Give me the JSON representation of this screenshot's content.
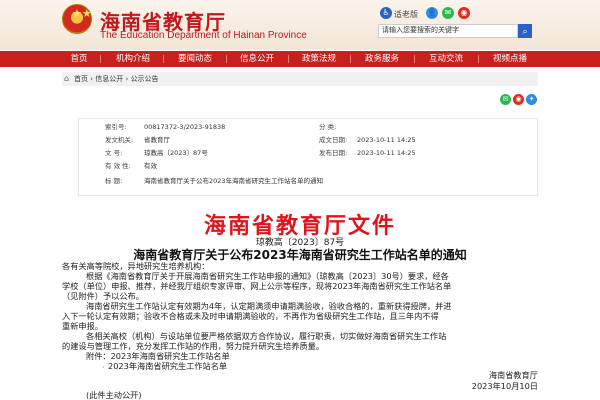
{
  "header": {
    "title": "海南省教育厅",
    "subtitle": "The Education Department of Hainan Province",
    "links": [
      "适老版"
    ],
    "search_placeholder": "请输入您要搜索的关键字"
  },
  "nav": {
    "items": [
      "首页",
      "机构介绍",
      "要闻动态",
      "信息公开",
      "政策法规",
      "政务服务",
      "互动交流",
      "视频点播"
    ]
  },
  "breadcrumb": {
    "items": [
      "首页",
      "信息公开",
      "公示公告"
    ],
    "separator": "›"
  },
  "meta": {
    "index_label": "索引号:",
    "index_value": "00817372-3/2023-91838",
    "category_label": "分    类:",
    "category_value": "",
    "org_label": "发文机关:",
    "org_value": "省教育厅",
    "date_label": "成文日期:",
    "date_value": "2023-10-11 14:25",
    "docno_label": "文    号:",
    "docno_value": "琼教高〔2023〕87号",
    "pubdate_label": "发布日期:",
    "pubdate_value": "2023-10-11 14:25",
    "validity_label": "有 效 性:",
    "validity_value": "有效",
    "title_label": "标    题:",
    "title_value": "海南省教育厅关于公布2023年海南省研究生工作站名单的通知"
  },
  "document": {
    "banner": "海南省教育厅文件",
    "number": "琼教高〔2023〕87号",
    "heading": "海南省教育厅关于公布2023年海南省研究生工作站名单的通知",
    "salutation": "各有关高等院校，异地研究生培养机构：",
    "para1_line1": "根据《海南省教育厅关于开展海南省研究生工作站申报的通知》（琼教高〔2023〕30号）要求，经各",
    "para1_line2": "学校（单位）申报、推荐，并经我厅组织专家评审、网上公示等程序，现将2023年海南省研究生工作站名单",
    "para1_line3": "（见附件）予以公布。",
    "para2_line1": "海南省研究生工作站认定有效期为4年，认定期满须申请期满验收，验收合格的，重新获得授牌，并进",
    "para2_line2": "入下一轮认定有效期；验收不合格或未及时申请期满验收的，不再作为省级研究生工作站，且三年内不得",
    "para2_line3": "重新申报。",
    "para3_line1": "各相关高校（机构）与设站单位要严格依据双方合作协议，履行职责，切实做好海南省研究生工作站",
    "para3_line2": "的建设与管理工作，充分发挥工作站的作用，努力提升研究生培养质量。",
    "attachment1": "附件：2023年海南省研究生工作站名单",
    "attachment2": "2023年海南省研究生工作站名单",
    "signer": "海南省教育厅",
    "sign_date": "2023年10月10日",
    "footer": "(此件主动公开)"
  }
}
